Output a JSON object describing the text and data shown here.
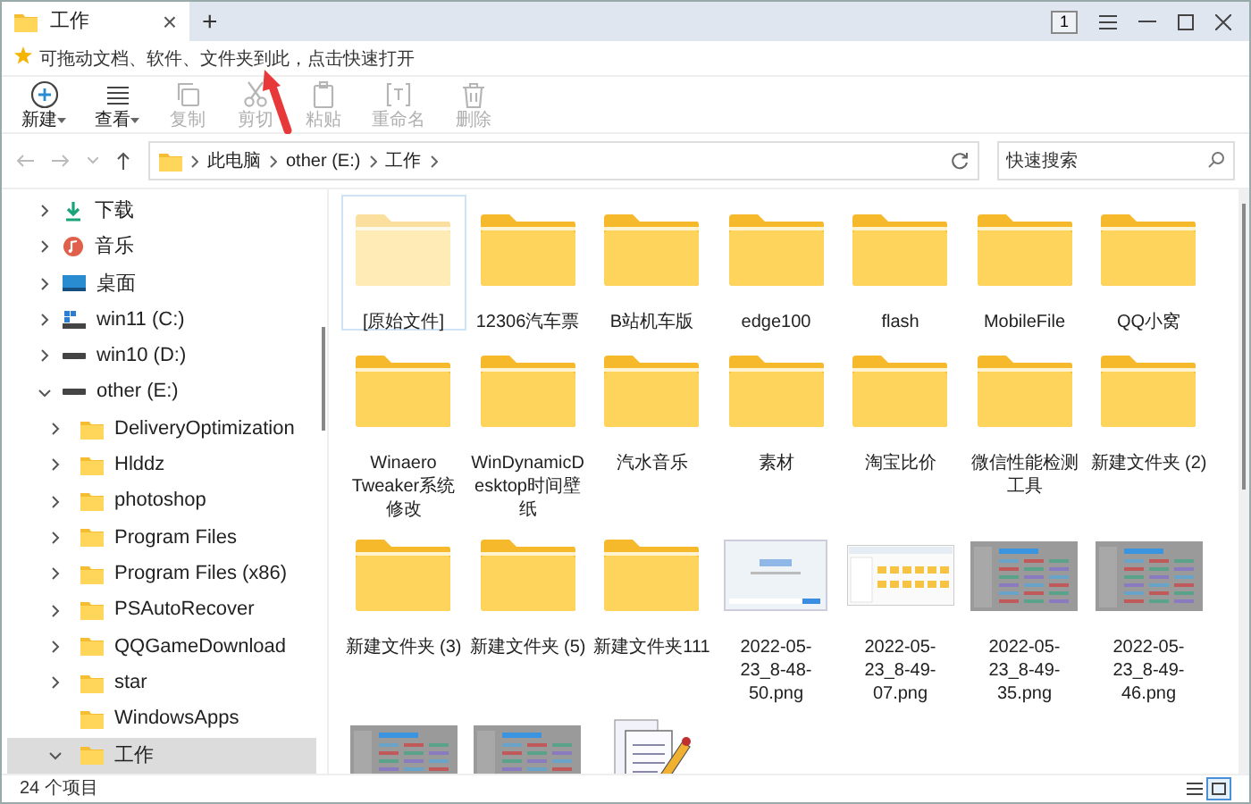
{
  "tab": {
    "title": "工作",
    "close": "×",
    "new": "+"
  },
  "window_controls": {
    "badge": "1"
  },
  "quick_bar": {
    "text": "可拖动文档、软件、文件夹到此，点击快速打开"
  },
  "toolbar": [
    {
      "label": "新建",
      "disabled": false,
      "dropdown": true
    },
    {
      "label": "查看",
      "disabled": false,
      "dropdown": true
    },
    {
      "label": "复制",
      "disabled": true,
      "dropdown": false
    },
    {
      "label": "剪切",
      "disabled": true,
      "dropdown": false
    },
    {
      "label": "粘贴",
      "disabled": true,
      "dropdown": false
    },
    {
      "label": "重命名",
      "disabled": true,
      "dropdown": false
    },
    {
      "label": "删除",
      "disabled": true,
      "dropdown": false
    }
  ],
  "breadcrumb": [
    "此电脑",
    "other (E:)",
    "工作"
  ],
  "search": {
    "placeholder": "快速搜索"
  },
  "sidebar": [
    {
      "label": "下载",
      "kind": "download",
      "expanded": false,
      "selected": false
    },
    {
      "label": "音乐",
      "kind": "music",
      "expanded": false,
      "selected": false
    },
    {
      "label": "桌面",
      "kind": "desktop",
      "expanded": false,
      "selected": false
    },
    {
      "label": "win11 (C:)",
      "kind": "sysdrive",
      "expanded": false,
      "selected": false
    },
    {
      "label": "win10 (D:)",
      "kind": "drive",
      "expanded": false,
      "selected": false
    },
    {
      "label": "other (E:)",
      "kind": "drive",
      "expanded": true,
      "selected": false,
      "children": [
        {
          "label": "DeliveryOptimization",
          "kind": "folder",
          "expanded": false,
          "selected": false
        },
        {
          "label": "Hlddz",
          "kind": "folder",
          "expanded": false,
          "selected": false
        },
        {
          "label": "photoshop",
          "kind": "folder",
          "expanded": false,
          "selected": false
        },
        {
          "label": "Program Files",
          "kind": "folder",
          "expanded": false,
          "selected": false
        },
        {
          "label": "Program Files (x86)",
          "kind": "folder",
          "expanded": false,
          "selected": false
        },
        {
          "label": "PSAutoRecover",
          "kind": "folder",
          "expanded": false,
          "selected": false
        },
        {
          "label": "QQGameDownload",
          "kind": "folder",
          "expanded": false,
          "selected": false
        },
        {
          "label": "star",
          "kind": "folder",
          "expanded": false,
          "selected": false
        },
        {
          "label": "WindowsApps",
          "kind": "folder",
          "leaf": true,
          "expanded": false,
          "selected": false
        },
        {
          "label": "工作",
          "kind": "folder",
          "expanded": true,
          "selected": true
        }
      ]
    }
  ],
  "files": [
    {
      "name": "[原始文件]",
      "kind": "folder",
      "selected": true
    },
    {
      "name": "12306汽车票",
      "kind": "folder",
      "selected": false
    },
    {
      "name": "B站机车版",
      "kind": "folder",
      "selected": false
    },
    {
      "name": "edge100",
      "kind": "folder",
      "selected": false
    },
    {
      "name": "flash",
      "kind": "folder",
      "selected": false
    },
    {
      "name": "MobileFile",
      "kind": "folder",
      "selected": false
    },
    {
      "name": "QQ小窝",
      "kind": "folder",
      "selected": false
    },
    {
      "name": "Winaero Tweaker系统修改",
      "kind": "folder",
      "selected": false
    },
    {
      "name": "WinDynamicDesktop时间壁纸",
      "kind": "folder",
      "selected": false
    },
    {
      "name": "汽水音乐",
      "kind": "folder",
      "selected": false
    },
    {
      "name": "素材",
      "kind": "folder",
      "selected": false
    },
    {
      "name": "淘宝比价",
      "kind": "folder",
      "selected": false
    },
    {
      "name": "微信性能检测工具",
      "kind": "folder",
      "selected": false
    },
    {
      "name": "新建文件夹 (2)",
      "kind": "folder",
      "selected": false
    },
    {
      "name": "新建文件夹 (3)",
      "kind": "folder",
      "selected": false
    },
    {
      "name": "新建文件夹 (5)",
      "kind": "folder",
      "selected": false
    },
    {
      "name": "新建文件夹111",
      "kind": "folder",
      "selected": false
    },
    {
      "name": "2022-05-23_8-48-50.png",
      "kind": "image_light",
      "selected": false
    },
    {
      "name": "2022-05-23_8-49-07.png",
      "kind": "image_explorer",
      "selected": false
    },
    {
      "name": "2022-05-23_8-49-35.png",
      "kind": "image_dark",
      "selected": false
    },
    {
      "name": "2022-05-23_8-49-46.png",
      "kind": "image_dark",
      "selected": false
    },
    {
      "kind": "image_dark",
      "selected": false
    },
    {
      "kind": "image_dark",
      "selected": false
    },
    {
      "kind": "document",
      "selected": false
    }
  ],
  "status_bar": {
    "count": "24 个项目",
    "view_modes": [
      {
        "kind": "details",
        "selected": false
      },
      {
        "kind": "icons",
        "selected": true
      }
    ]
  }
}
